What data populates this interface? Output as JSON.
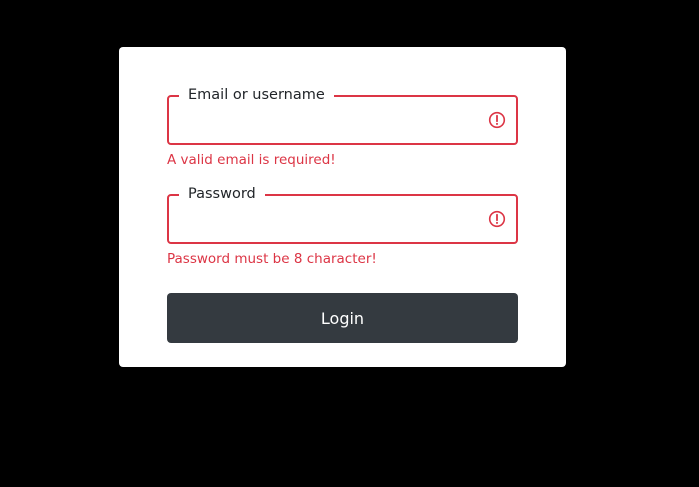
{
  "form": {
    "email": {
      "label": "Email or username",
      "value": "",
      "placeholder": "",
      "error": "A valid email is required!",
      "icon": "alert-circle-icon"
    },
    "password": {
      "label": "Password",
      "value": "",
      "placeholder": "",
      "error": "Password must be 8 character!",
      "icon": "alert-circle-icon"
    },
    "login_label": "Login"
  },
  "colors": {
    "background": "#000000",
    "card": "#ffffff",
    "error": "#dc3545",
    "button": "#343a40",
    "button_text": "#ffffff",
    "label_text": "#212529"
  }
}
